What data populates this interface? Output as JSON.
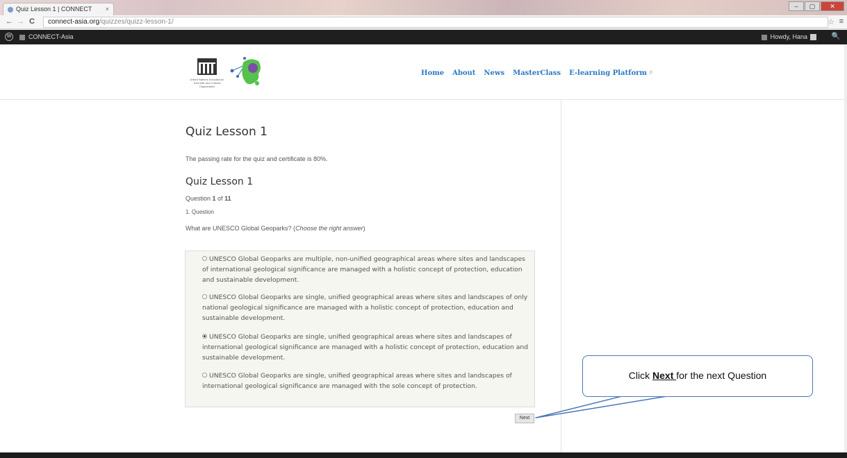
{
  "browser": {
    "tab_title": "Quiz Lesson 1 | CONNECT",
    "tab_close": "×",
    "url_host": "connect-asia.org",
    "url_path": "/quizzes/quizz-lesson-1/",
    "back": "←",
    "forward": "→",
    "reload": "C",
    "bookmark": "☆",
    "menu": "≡",
    "minimize": "–",
    "maximize": "▢",
    "close": "✕"
  },
  "adminbar": {
    "site_name": "CONNECT-Asia",
    "howdy": "Howdy, Hana",
    "search": "🔍"
  },
  "header": {
    "unesco_caption": "United Nations Educational, Scientific and Cultural Organization",
    "nav": [
      "Home",
      "About",
      "News",
      "MasterClass",
      "E-learning Platform"
    ],
    "search_icon": "⌕"
  },
  "quiz": {
    "title": "Quiz Lesson 1",
    "passing_text": "The passing rate for the quiz and certificate is 80%.",
    "subtitle": "Quiz Lesson 1",
    "question_prefix": "Question ",
    "question_current": "1",
    "question_of": " of ",
    "question_total": "11",
    "question_label": "1. Question",
    "question_text": "What are UNESCO Global Geoparks? (",
    "question_hint": "Choose the right answer",
    "question_close": ")",
    "answers": [
      "UNESCO Global Geoparks are multiple, non-unified geographical areas where sites and landscapes of international geological significance are managed with a holistic concept of protection, education and sustainable development.",
      "UNESCO Global Geoparks are single, unified geographical areas where sites and landscapes of only national geological significance are managed with a holistic concept of protection, education and sustainable development.",
      "UNESCO Global Geoparks are single, unified geographical areas where sites and landscapes of international geological significance are managed with a holistic concept of protection, education and sustainable development.",
      "UNESCO Global Geoparks are single, unified geographical areas where sites and landscapes of international geological significance are managed with the sole concept of protection."
    ],
    "selected_index": 2,
    "next_label": "Next"
  },
  "callout": {
    "prefix": "Click ",
    "emphasis": "Next ",
    "suffix": "for the next Question"
  },
  "colors": {
    "nav_link": "#2a79c4",
    "callout_border": "#4a76b8",
    "adminbar_bg": "#1f1f1f",
    "answers_bg": "#f4f6ef"
  }
}
